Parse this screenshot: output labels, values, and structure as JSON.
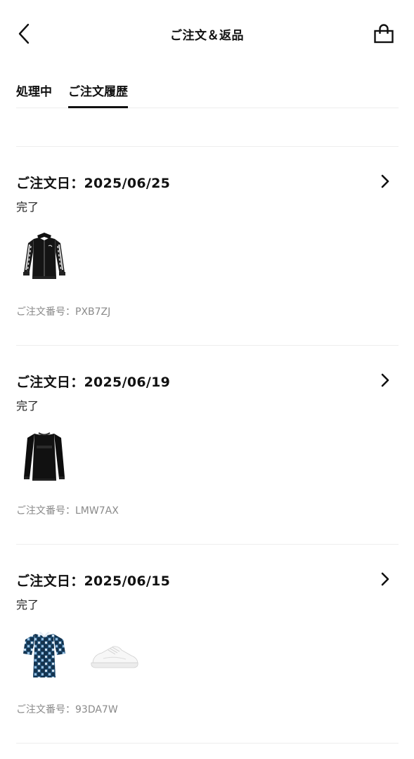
{
  "header": {
    "title": "ご注文＆返品",
    "back_icon": "chevron-left-icon",
    "bag_icon": "shopping-bag-icon"
  },
  "tabs": [
    {
      "label": "処理中",
      "active": false
    },
    {
      "label": "ご注文履歴",
      "active": true
    }
  ],
  "orders": [
    {
      "date_label": "ご注文日：2025/06/25",
      "status": "完了",
      "items": [
        "black-track-jacket"
      ],
      "order_number_label": "ご注文番号：PXB7ZJ"
    },
    {
      "date_label": "ご注文日：2025/06/19",
      "status": "完了",
      "items": [
        "black-sweatshirt"
      ],
      "order_number_label": "ご注文番号：LMW7AX"
    },
    {
      "date_label": "ご注文日：2025/06/15",
      "status": "完了",
      "items": [
        "blue-print-shirt",
        "white-sneaker"
      ],
      "order_number_label": "ご注文番号：93DA7W"
    }
  ],
  "colors": {
    "text": "#111111",
    "muted": "#8a8a8a",
    "divider": "#eeeeee"
  }
}
